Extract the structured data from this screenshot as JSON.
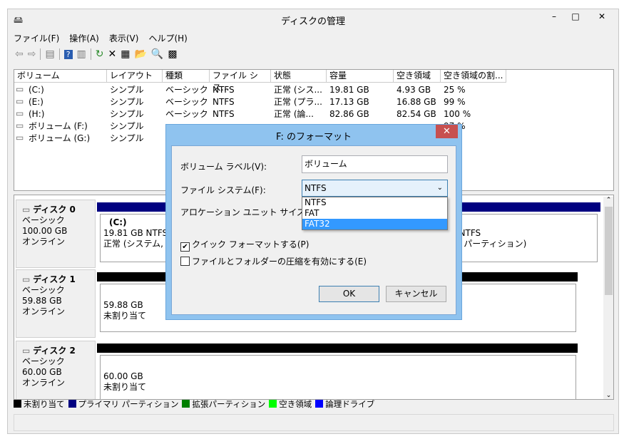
{
  "window": {
    "title": "ディスクの管理",
    "minimize": "–",
    "maximize": "□",
    "close": "✕"
  },
  "menu": [
    "ファイル(F)",
    "操作(A)",
    "表示(V)",
    "ヘルプ(H)"
  ],
  "toolbar": [
    "back-icon",
    "forward-icon",
    "console-tree-icon",
    "help-icon",
    "action-pane-icon",
    "refresh-icon",
    "delete-icon",
    "properties-icon",
    "open-icon",
    "explore-icon",
    "settings-icon"
  ],
  "volume_list": {
    "columns": [
      "ボリューム",
      "レイアウト",
      "種類",
      "ファイル シス...",
      "状態",
      "容量",
      "空き領域",
      "空き領域の割..."
    ],
    "rows": [
      {
        "name": "(C:)",
        "layout": "シンプル",
        "type": "ベーシック",
        "fs": "NTFS",
        "status": "正常 (シス...",
        "capacity": "19.81 GB",
        "free": "4.93 GB",
        "pct": "25 %"
      },
      {
        "name": "(E:)",
        "layout": "シンプル",
        "type": "ベーシック",
        "fs": "NTFS",
        "status": "正常 (プラ...",
        "capacity": "17.13 GB",
        "free": "16.88 GB",
        "pct": "99 %"
      },
      {
        "name": "(H:)",
        "layout": "シンプル",
        "type": "ベーシック",
        "fs": "NTFS",
        "status": "正常 (論...",
        "capacity": "82.86 GB",
        "free": "82.54 GB",
        "pct": "100 %"
      },
      {
        "name": "ボリューム (F:)",
        "layout": "シンプル",
        "pct": "97 %"
      },
      {
        "name": "ボリューム (G:)",
        "layout": "シンプル",
        "pct": "%"
      }
    ]
  },
  "disks": [
    {
      "name": "ディスク 0",
      "type": "ベーシック",
      "size": "100.00 GB",
      "state": "オンライン",
      "partitions": [
        {
          "name": "(C:)",
          "size": "19.81 GB NTFS",
          "status": "正常 (システム, ブー"
        },
        {
          "size": "17.13 GB NTFS",
          "status": "正常 (プライマリ パーティション)"
        }
      ]
    },
    {
      "name": "ディスク 1",
      "type": "ベーシック",
      "size": "59.88 GB",
      "state": "オンライン",
      "partitions": [
        {
          "size": "59.88 GB",
          "status": "未割り当て"
        }
      ]
    },
    {
      "name": "ディスク 2",
      "type": "ベーシック",
      "size": "60.00 GB",
      "state": "オンライン",
      "partitions": [
        {
          "size": "60.00 GB",
          "status": "未割り当て"
        }
      ]
    }
  ],
  "legend": [
    {
      "label": "未割り当て",
      "color": "#000000"
    },
    {
      "label": "プライマリ パーティション",
      "color": "#000080"
    },
    {
      "label": "拡張パーティション",
      "color": "#008000"
    },
    {
      "label": "空き領域",
      "color": "#00ff00"
    },
    {
      "label": "論理ドライブ",
      "color": "#0000ff"
    }
  ],
  "dialog": {
    "title": "F: のフォーマット",
    "close": "✕",
    "volume_label_label": "ボリューム ラベル(V):",
    "volume_label_value": "ボリューム",
    "fs_label": "ファイル システム(F):",
    "fs_value": "NTFS",
    "fs_options": [
      "NTFS",
      "FAT",
      "FAT32"
    ],
    "fs_highlighted": "FAT32",
    "alloc_label": "アロケーション ユニット サイズ(A):",
    "quick_format": {
      "label": "クイック フォーマットする(P)",
      "checked": true
    },
    "compression": {
      "label": "ファイルとフォルダーの圧縮を有効にする(E)",
      "checked": false
    },
    "ok": "OK",
    "cancel": "キャンセル"
  }
}
